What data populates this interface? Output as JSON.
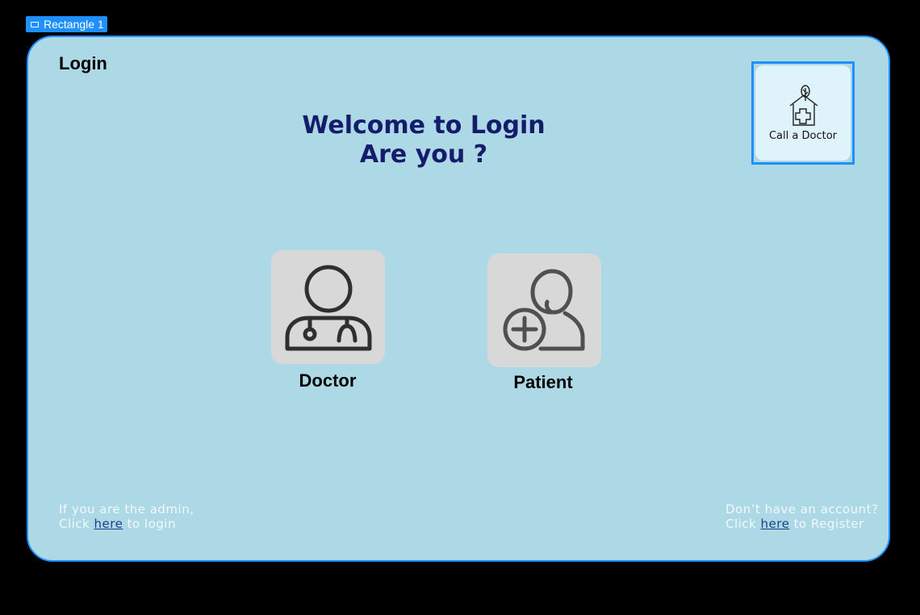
{
  "frame": {
    "tag_label": "Rectangle 1"
  },
  "header": {
    "title": "Login"
  },
  "hero": {
    "line1": "Welcome to Login",
    "line2": "Are you ?"
  },
  "logo": {
    "text": "Call a Doctor",
    "icon": "house-medical-tree-icon"
  },
  "roles": [
    {
      "label": "Doctor",
      "icon": "doctor-stethoscope-icon"
    },
    {
      "label": "Patient",
      "icon": "patient-add-icon"
    }
  ],
  "footer_left": {
    "line1": "If you are the admin,",
    "prefix": "Click ",
    "link": "here",
    "suffix": " to login"
  },
  "footer_right": {
    "line1": "Don’t have an account?",
    "prefix": "Click ",
    "link": "here",
    "suffix": " to Register"
  },
  "colors": {
    "background": "#000000",
    "card": "#add8e6",
    "accent": "#1e90ff",
    "heading": "#141c6b",
    "link": "#1f3e8a",
    "tile": "#d8d8d8"
  }
}
